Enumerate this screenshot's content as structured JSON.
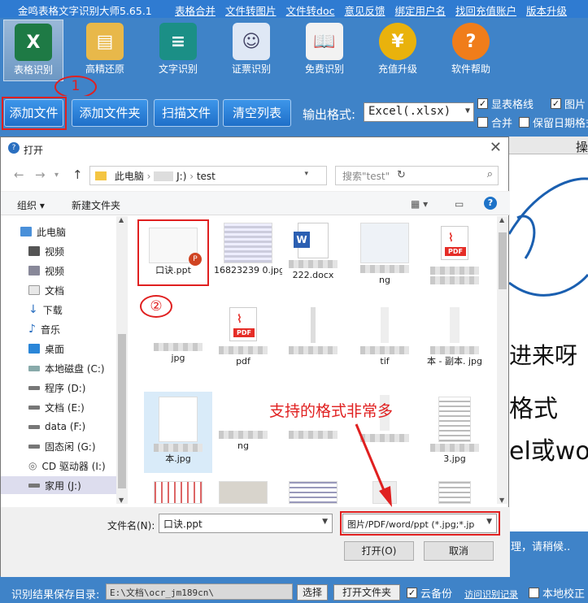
{
  "app": {
    "title": "金鸣表格文字识别大师5.65.1",
    "top_links": [
      "表格合并",
      "文件转图片",
      "文件转doc",
      "意见反馈",
      "绑定用户名",
      "找回充值账户",
      "版本升级"
    ]
  },
  "toolbar": {
    "tools": [
      {
        "label": "表格识别",
        "icon": "excel-icon",
        "color": "#1e7a45"
      },
      {
        "label": "高精还原",
        "icon": "document-restore-icon",
        "color": "#d98a1a"
      },
      {
        "label": "文字识别",
        "icon": "text-doc-icon",
        "color": "#1b8f86"
      },
      {
        "label": "证票识别",
        "icon": "id-card-icon",
        "color": "#6a8fc8"
      },
      {
        "label": "免费识别",
        "icon": "reader-icon",
        "color": "#8c8c8c"
      },
      {
        "label": "充值升级",
        "icon": "yen-coin-icon",
        "color": "#e9b20c"
      },
      {
        "label": "软件帮助",
        "icon": "help-icon",
        "color": "#f07d1a"
      }
    ]
  },
  "annotations": {
    "circle1": "1",
    "circle2": "②",
    "note": "支持的格式非常多"
  },
  "actions": {
    "add_file": "添加文件",
    "add_folder": "添加文件夹",
    "scan_file": "扫描文件",
    "clear_list": "清空列表",
    "output_label": "输出格式:",
    "output_value": "Excel(.xlsx)",
    "show_gridlines": "显表格线",
    "show_gridlines_checked": true,
    "image_opt": "图片",
    "image_opt_checked": true,
    "merge": "合并",
    "merge_checked": false,
    "keep_date": "保留日期格式",
    "keep_date_checked": false
  },
  "right_pane": {
    "header": "操",
    "line1": "进来呀",
    "line2": "格式",
    "line3": "el或wo"
  },
  "status": {
    "processing": "理，请稍候.."
  },
  "dialog": {
    "title": "打开",
    "path_pc": "此电脑",
    "path_drive": "J:)",
    "path_folder": "test",
    "search_placeholder": "搜索\"test\"",
    "organize": "组织 ▾",
    "new_folder": "新建文件夹",
    "tree": [
      "此电脑",
      "视频",
      "视频",
      "文档",
      "下载",
      "音乐",
      "桌面",
      "本地磁盘 (C:)",
      "程序 (D:)",
      "文档 (E:)",
      "data (F:)",
      "固态闲 (G:)",
      "CD 驱动器 (I:)",
      "家用 (J:)"
    ],
    "files_row1": [
      "口诀.ppt",
      "16823239 0.jpg",
      "222.docx",
      "ng",
      ""
    ],
    "files_row2": [
      "jpg",
      "pdf",
      "",
      "tif",
      "本 - 副本. jpg"
    ],
    "files_row3": [
      "本.jpg",
      "ng",
      "",
      "",
      "3.jpg"
    ],
    "filename_label": "文件名(N):",
    "filename_value": "口诀.ppt",
    "filetype_value": "图片/PDF/word/ppt (*.jpg;*.jp",
    "open_btn": "打开(O)",
    "cancel_btn": "取消"
  },
  "bottom": {
    "save_dir_label": "识别结果保存目录:",
    "save_dir_value": "E:\\文档\\ocr_jm189cn\\",
    "select_btn": "选择",
    "open_folder_btn": "打开文件夹",
    "backup": "云备份",
    "backup_checked": true,
    "access_log": "访问识别记录",
    "local_check": "本地校正",
    "local_check_checked": false
  }
}
